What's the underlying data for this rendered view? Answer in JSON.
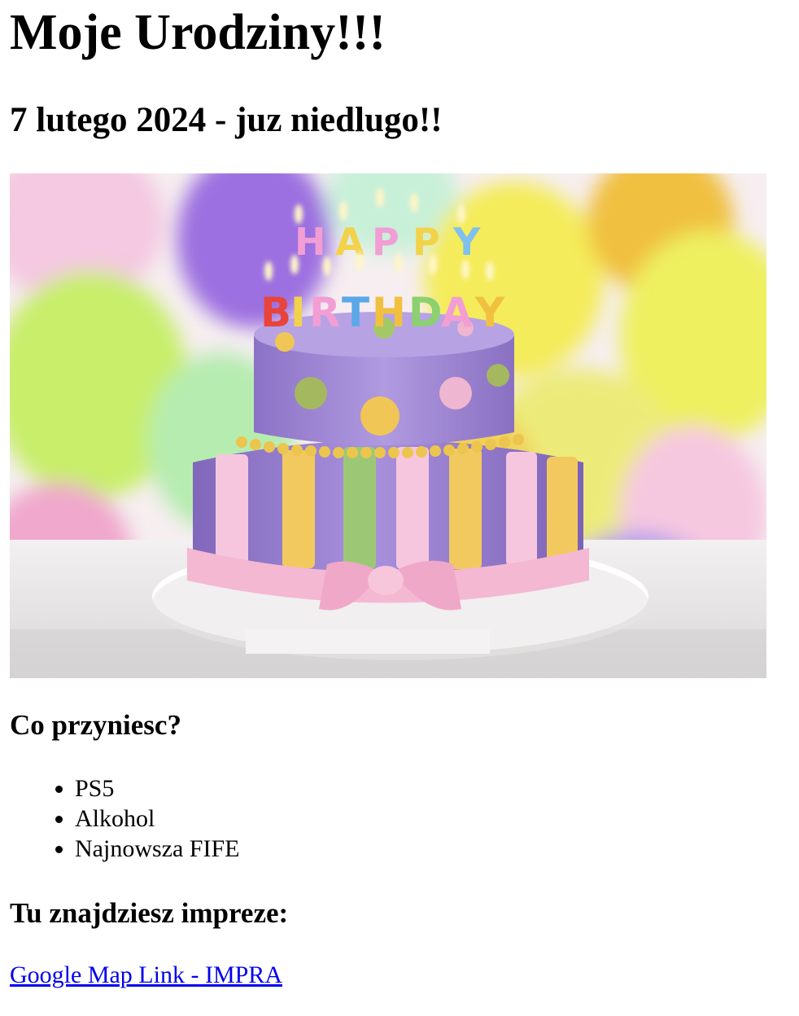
{
  "page": {
    "title": "Moje Urodziny!!!",
    "date_line": "7 lutego 2024 - juz niedlugo!!"
  },
  "image": {
    "icon": "birthday-cake-photo",
    "candle_letters": [
      "HAPPY",
      "BIRTHDAY"
    ]
  },
  "bring": {
    "heading": "Co przyniesc?",
    "items": [
      "PS5",
      "Alkohol",
      "Najnowsza FIFE"
    ]
  },
  "location": {
    "heading": "Tu znajdziesz impreze:",
    "link_text": "Google Map Link - IMPRA"
  },
  "colors": {
    "link": "#0000ee",
    "text": "#000000",
    "background": "#ffffff"
  }
}
